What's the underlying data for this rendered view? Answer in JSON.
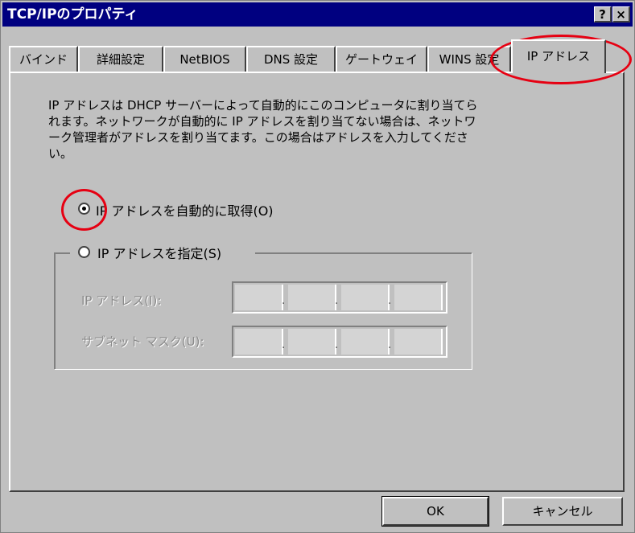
{
  "window": {
    "title": "TCP/IPのプロパティ",
    "help_glyph": "?",
    "close_glyph": "×"
  },
  "tabs": [
    {
      "label": "バインド"
    },
    {
      "label": "詳細設定"
    },
    {
      "label": "NetBIOS"
    },
    {
      "label": "DNS 設定"
    },
    {
      "label": "ゲートウェイ"
    },
    {
      "label": "WINS 設定"
    },
    {
      "label": "IP アドレス",
      "active": true
    }
  ],
  "description": "IP アドレスは DHCP サーバーによって自動的にこのコンピュータに割り当てら\nれます。ネットワークが自動的に IP アドレスを割り当てない場合は、ネットワ\nーク管理者がアドレスを割り当てます。この場合はアドレスを入力してくださ\nい。",
  "radio_auto": {
    "label": "IP アドレスを自動的に取得(O)",
    "selected": true
  },
  "radio_manual": {
    "label": "IP アドレスを指定(S)",
    "selected": false
  },
  "ip_address": {
    "label": "IP アドレス(I):",
    "octets": [
      "",
      "",
      "",
      ""
    ]
  },
  "subnet_mask": {
    "label": "サブネット マスク(U):",
    "octets": [
      "",
      "",
      "",
      ""
    ]
  },
  "buttons": {
    "ok": "OK",
    "cancel": "キャンセル"
  },
  "colors": {
    "titlebar": "#000080",
    "face": "#c0c0c0",
    "annotation": "#e60012"
  }
}
